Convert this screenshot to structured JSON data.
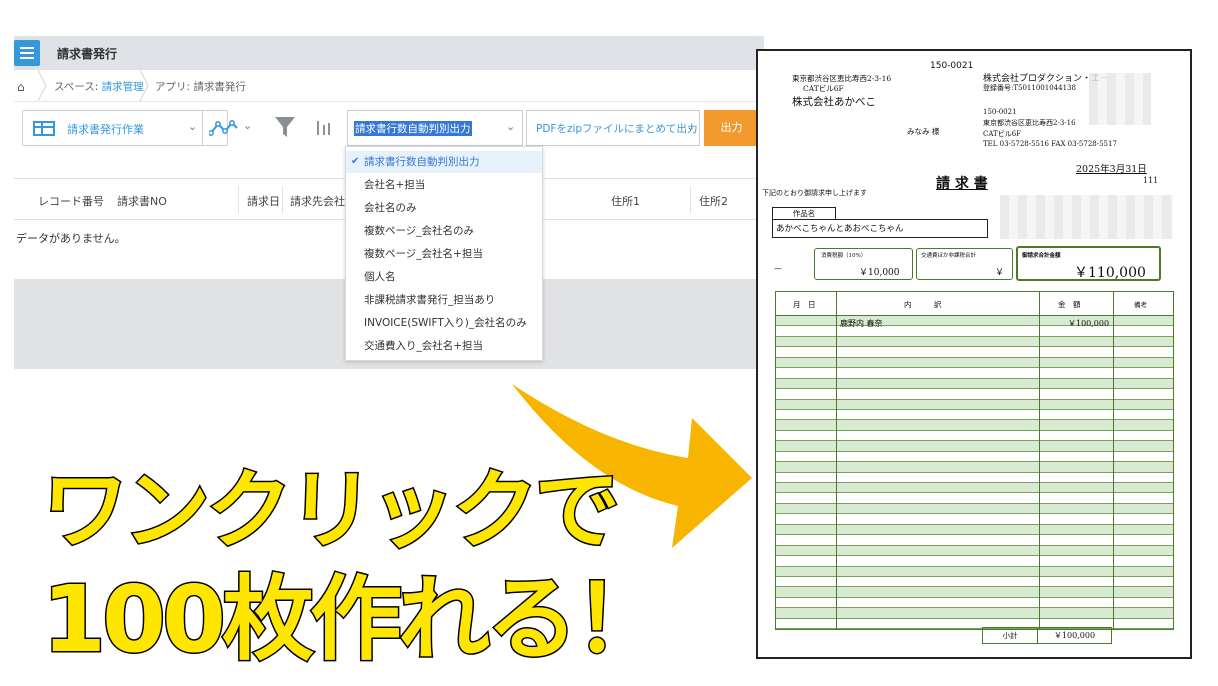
{
  "app": {
    "title": "請求書発行",
    "breadcrumb": {
      "space_prefix": "スペース: ",
      "space_name": "請求管理",
      "app_label": "アプリ: 請求書発行"
    },
    "toolbar": {
      "view_label": "請求書発行作業",
      "print_setting_value": "請求書行数自動判別出力",
      "zip_label": "PDFをzipファイルにまとめて出力",
      "output_label": "出力"
    },
    "table_headers": [
      "レコード番号",
      "請求書NO",
      "請求日",
      "請求先会社名",
      "住所1",
      "住所2"
    ],
    "no_data": "データがありません。",
    "dropdown_items": [
      "請求書行数自動判別出力",
      "会社名+担当",
      "会社名のみ",
      "複数ページ_会社名のみ",
      "複数ページ_会社名+担当",
      "個人名",
      "非課税請求書発行_担当あり",
      "INVOICE(SWIFT入り)_会社名のみ",
      "交通費入り_会社名+担当"
    ],
    "selected_index": 0,
    "colors": {
      "accent": "#3498db",
      "output_button": "#f39a2e",
      "highlight": "#3478d4"
    }
  },
  "catchphrase": {
    "line1": "ワンクリックで",
    "line2": "100枚作れる！",
    "fill_color": "#ffe600",
    "arrow_color": "#f7b500"
  },
  "invoice": {
    "postal_top": "150-0021",
    "client_address1": "東京都渋谷区恵比寿西2-3-16",
    "client_address2": "CATビル6F",
    "client_name": "株式会社あかべこ",
    "honorific_person": "みなみ 様",
    "issuer_name": "株式会社プロダクション・エー",
    "registration": "登録番号:T5011001044138",
    "issuer_postal": "150-0021",
    "issuer_address1": "東京都渋谷区恵比寿西2-3-16",
    "issuer_address2": "CATビル6F",
    "issuer_tel": "TEL 03-5728-5516 FAX 03-5728-5517",
    "date": "2025年3月31日",
    "title": "請 求 書",
    "number": "111",
    "intro": "下記のとおり御請求申し上げます",
    "work_label": "作品名",
    "work_name": "あかべこちゃんとあおべこちゃん",
    "dash": "—",
    "tax_label": "消費税額（10%）",
    "tax_value": "￥10,000",
    "transport_label": "交通費ほか非課税合計",
    "transport_value": "￥",
    "total_label": "御請求合計金額",
    "total_value": "￥110,000",
    "col_date": "月　日",
    "col_desc": "内　　　訳",
    "col_amount": "金　額",
    "col_note": "備考",
    "line_desc": "鹿野内 春奈",
    "line_amount": "￥100,000",
    "subtotal_label": "小計",
    "subtotal_value": "￥100,000"
  }
}
